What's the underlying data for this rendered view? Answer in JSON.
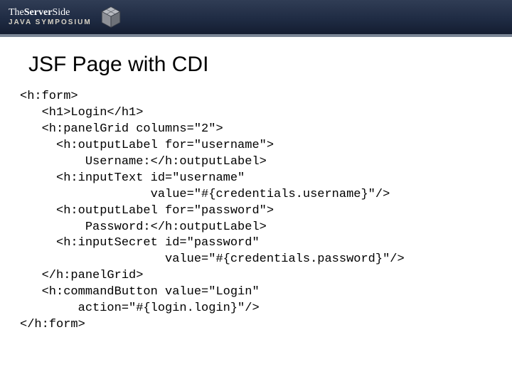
{
  "header": {
    "brand_line1_a": "The",
    "brand_line1_b": "Server",
    "brand_line1_c": "Side",
    "brand_line2": "JAVA SYMPOSIUM"
  },
  "slide": {
    "title": "JSF Page with CDI"
  },
  "code": {
    "lines": [
      "<h:form>",
      "   <h1>Login</h1>",
      "   <h:panelGrid columns=\"2\">",
      "     <h:outputLabel for=\"username\">",
      "         Username:</h:outputLabel>",
      "     <h:inputText id=\"username\"",
      "                  value=\"#{credentials.username}\"/>",
      "     <h:outputLabel for=\"password\">",
      "         Password:</h:outputLabel>",
      "     <h:inputSecret id=\"password\"",
      "                    value=\"#{credentials.password}\"/>",
      "   </h:panelGrid>",
      "   <h:commandButton value=\"Login\"",
      "        action=\"#{login.login}\"/>",
      "</h:form>"
    ]
  }
}
